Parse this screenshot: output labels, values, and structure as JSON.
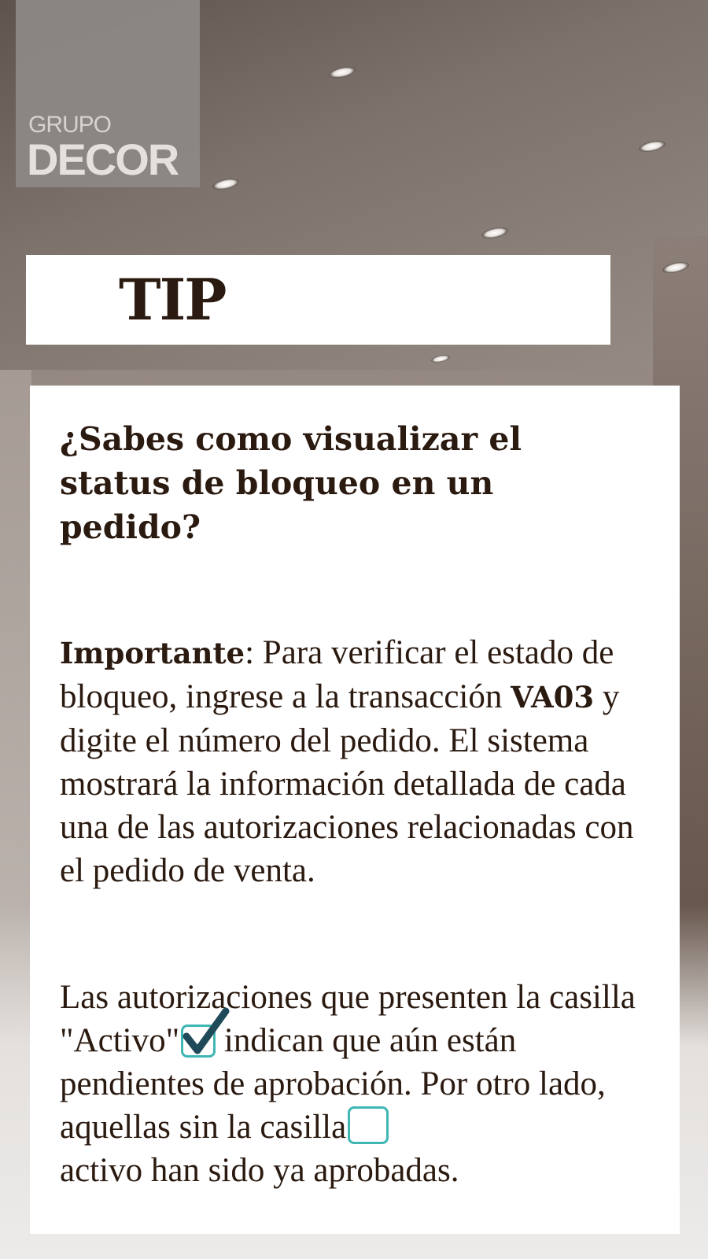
{
  "logo": {
    "line1": "GRUPO",
    "line2": "DECOR"
  },
  "banner": {
    "title": "TIP"
  },
  "card": {
    "question": "¿Sabes como visualizar el status de bloqueo en un pedido?",
    "p1_bold": "Importante",
    "p1_a": ": Para verificar el estado de bloqueo, ingrese a la transacción ",
    "p1_code": "VA03",
    "p1_b": " y digite el número del pedido. El sistema mostrará la información detallada de cada una de las autorizaciones relacionadas con el pedido de venta.",
    "p2_a": "Las autorizaciones que presenten la casilla \"Activo\"",
    "p2_b": "  indican que aún están pendientes de aprobación. Por otro lado, aquellas sin la casilla",
    "p2_c": " activo han sido ya aprobadas."
  },
  "colors": {
    "text": "#2b1a10",
    "checkbox": "#3fb7b4",
    "check": "#1f4a5a"
  },
  "icons": {
    "checked": "checked-checkbox-icon",
    "empty": "empty-checkbox-icon"
  }
}
